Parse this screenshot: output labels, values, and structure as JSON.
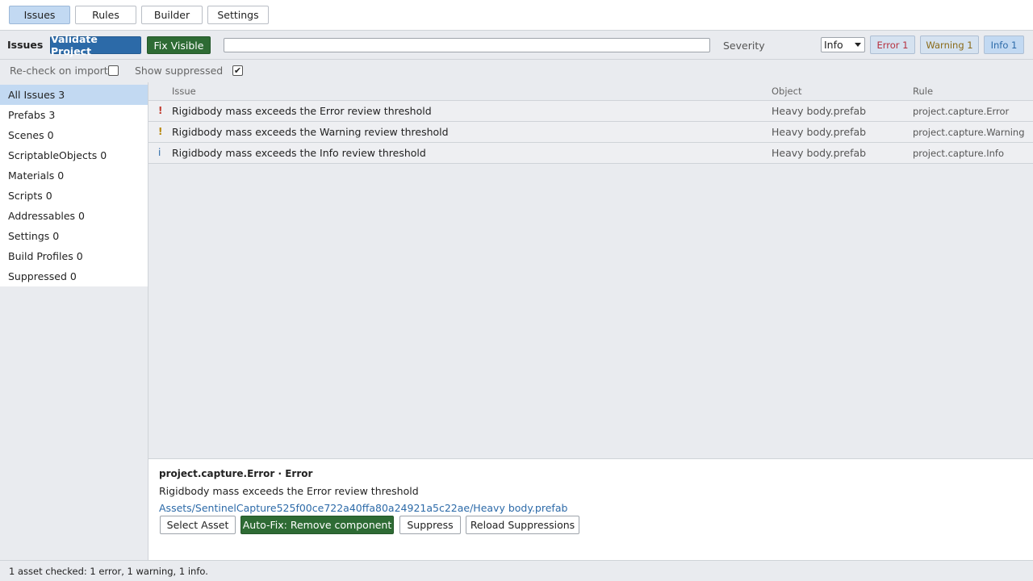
{
  "tabs": [
    {
      "label": "Issues",
      "active": true
    },
    {
      "label": "Rules",
      "active": false
    },
    {
      "label": "Builder",
      "active": false
    },
    {
      "label": "Settings",
      "active": false
    }
  ],
  "toolbar": {
    "title": "Issues",
    "validate_label": "Validate Project",
    "fix_visible_label": "Fix Visible",
    "search_value": "",
    "severity_label": "Severity",
    "severity_value": "Info",
    "chips": {
      "error": "Error 1",
      "warning": "Warning 1",
      "info": "Info 1"
    }
  },
  "options": {
    "recheck_label": "Re-check on import",
    "recheck_checked": false,
    "suppressed_label": "Show suppressed",
    "suppressed_checked": true
  },
  "sidebar": {
    "items": [
      {
        "label": "All Issues 3",
        "active": true
      },
      {
        "label": "Prefabs 3"
      },
      {
        "label": "Scenes 0"
      },
      {
        "label": "ScriptableObjects 0"
      },
      {
        "label": "Materials 0"
      },
      {
        "label": "Scripts 0"
      },
      {
        "label": "Addressables 0"
      },
      {
        "label": "Settings 0"
      },
      {
        "label": "Build Profiles 0"
      },
      {
        "label": "Suppressed 0"
      }
    ]
  },
  "table": {
    "headers": {
      "issue": "Issue",
      "object": "Object",
      "rule": "Rule"
    },
    "rows": [
      {
        "icon": "!",
        "severity": "error",
        "issue": "Rigidbody mass exceeds the Error review threshold",
        "object": "Heavy body.prefab",
        "rule": "project.capture.Error"
      },
      {
        "icon": "!",
        "severity": "warning",
        "issue": "Rigidbody mass exceeds the Warning review threshold",
        "object": "Heavy body.prefab",
        "rule": "project.capture.Warning"
      },
      {
        "icon": "i",
        "severity": "info",
        "issue": "Rigidbody mass exceeds the Info review threshold",
        "object": "Heavy body.prefab",
        "rule": "project.capture.Info"
      }
    ]
  },
  "detail": {
    "title": "project.capture.Error · Error",
    "message": "Rigidbody mass exceeds the Error review threshold",
    "path": "Assets/SentinelCapture525f00ce722a40ffa80a24921a5c22ae/Heavy body.prefab",
    "buttons": {
      "select": "Select Asset",
      "autofix": "Auto-Fix: Remove component",
      "suppress": "Suppress",
      "reload": "Reload Suppressions"
    }
  },
  "status": "1 asset checked: 1 error, 1 warning, 1 info.",
  "colors": {
    "error": "#c0392b",
    "warning": "#b8860b",
    "info": "#2c6aa8",
    "accent": "#2c6aa8",
    "fix": "#2e6b34"
  }
}
